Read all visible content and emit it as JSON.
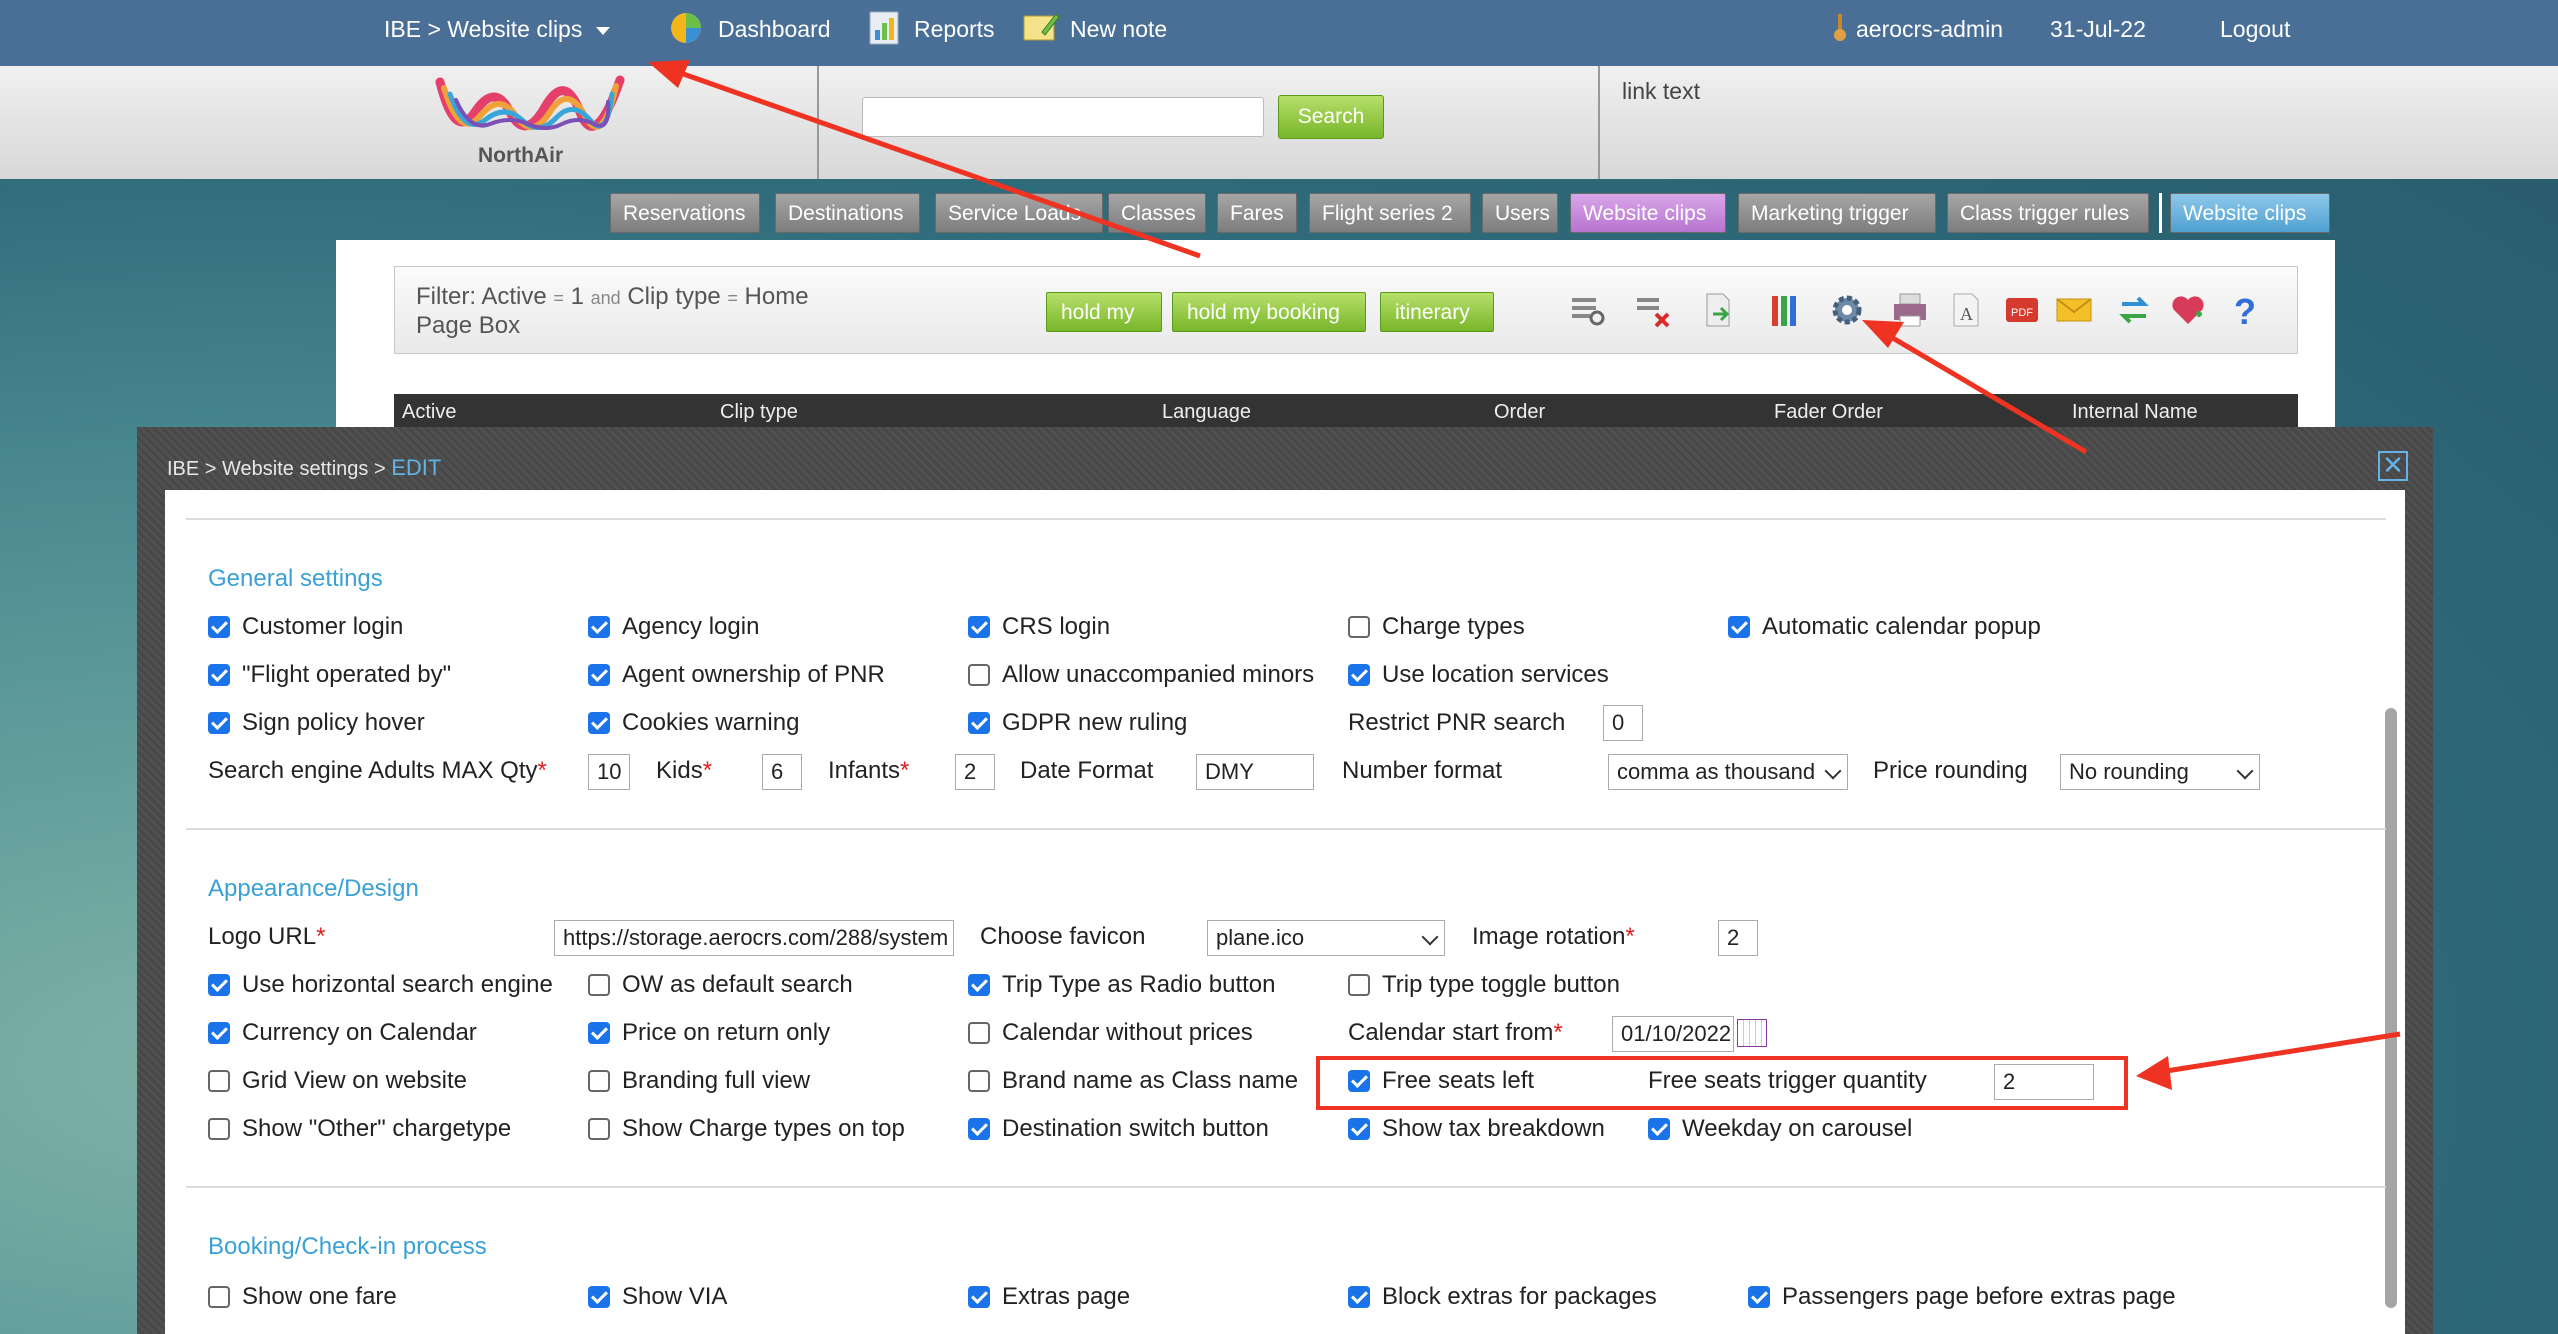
{
  "topbar": {
    "breadcrumb": "IBE > Website clips",
    "dashboard": "Dashboard",
    "reports": "Reports",
    "new_note": "New note",
    "user": "aerocrs-admin",
    "date": "31-Jul-22",
    "logout": "Logout"
  },
  "header": {
    "logo_text": "NorthAir",
    "search_value": "",
    "search_button": "Search",
    "link_text": "link text"
  },
  "nav": {
    "tabs": [
      "Reservations",
      "Destinations",
      "Service Loads",
      "Classes",
      "Fares",
      "Flight series 2",
      "Users",
      "Website clips",
      "Marketing trigger",
      "Class trigger rules",
      "Website clips"
    ]
  },
  "filter": {
    "label_active": "Filter: Active",
    "eq1": "=",
    "val_active": "1",
    "and": "and",
    "label_cliptype": "Clip type",
    "eq2": "=",
    "val_cliptype": "Home",
    "line2": "Page Box",
    "buttons": [
      "hold my",
      "hold my booking",
      "itinerary"
    ]
  },
  "toolbar_icons": [
    "search-list-icon",
    "delete-icon",
    "export-icon",
    "columns-icon",
    "settings-icon",
    "print-icon",
    "text-icon",
    "pdf-icon",
    "email-icon",
    "refresh-icon",
    "favorite-icon",
    "help-icon"
  ],
  "grid": {
    "columns": [
      "Active",
      "Clip type",
      "Language",
      "Order",
      "Fader Order",
      "Internal Name"
    ]
  },
  "modal": {
    "crumb": "IBE > Website settings >",
    "crumb_edit": "EDIT",
    "close": "✕",
    "general": {
      "title": "General settings",
      "customer_login": "Customer login",
      "agency_login": "Agency login",
      "crs_login": "CRS login",
      "charge_types": "Charge types",
      "auto_calendar": "Automatic calendar popup",
      "flight_operated": "\"Flight operated by\"",
      "agent_ownership": "Agent ownership of PNR",
      "unaccompanied": "Allow unaccompanied minors",
      "location_services": "Use location services",
      "sign_policy": "Sign policy hover",
      "cookies_warning": "Cookies warning",
      "gdpr": "GDPR new ruling",
      "restrict_pnr": "Restrict PNR search",
      "restrict_pnr_value": "0",
      "adults_max": "Search engine Adults MAX Qty",
      "adults_max_value": "10",
      "kids": "Kids",
      "kids_value": "6",
      "infants": "Infants",
      "infants_value": "2",
      "date_format": "Date Format",
      "date_format_value": "DMY",
      "number_format": "Number format",
      "number_format_value": "comma as thousand",
      "price_rounding": "Price rounding",
      "price_rounding_value": "No rounding",
      "required_mark": "*"
    },
    "appearance": {
      "title": "Appearance/Design",
      "logo_url": "Logo URL",
      "logo_url_value": "https://storage.aerocrs.com/288/system",
      "choose_favicon": "Choose favicon",
      "favicon_value": "plane.ico",
      "image_rotation": "Image rotation",
      "image_rotation_value": "2",
      "horizontal_search": "Use horizontal search engine",
      "ow_default": "OW as default search",
      "trip_radio": "Trip Type as Radio button",
      "trip_toggle": "Trip type toggle button",
      "currency_calendar": "Currency on Calendar",
      "price_return": "Price on return only",
      "calendar_no_prices": "Calendar without prices",
      "calendar_start": "Calendar start from",
      "calendar_start_value": "01/10/2022",
      "grid_view": "Grid View on website",
      "branding_full": "Branding full view",
      "brand_class": "Brand name as Class name",
      "free_seats": "Free seats left",
      "free_seats_trigger": "Free seats trigger quantity",
      "free_seats_trigger_value": "2",
      "show_other": "Show \"Other\" chargetype",
      "charge_top": "Show Charge types on top",
      "destination_switch": "Destination switch button",
      "tax_breakdown": "Show tax breakdown",
      "weekday_carousel": "Weekday on carousel"
    },
    "booking": {
      "title": "Booking/Check-in process",
      "show_one_fare": "Show one fare",
      "show_via": "Show VIA",
      "extras_page": "Extras page",
      "block_extras": "Block extras for packages",
      "passengers_before": "Passengers page before extras page"
    }
  },
  "colors": {
    "topbar": "#4a6f96",
    "accent_blue": "#3aa0d6",
    "checkbox_blue": "#1a73e8",
    "annotation_red": "#ee3322",
    "green_button": "#78b62a"
  }
}
